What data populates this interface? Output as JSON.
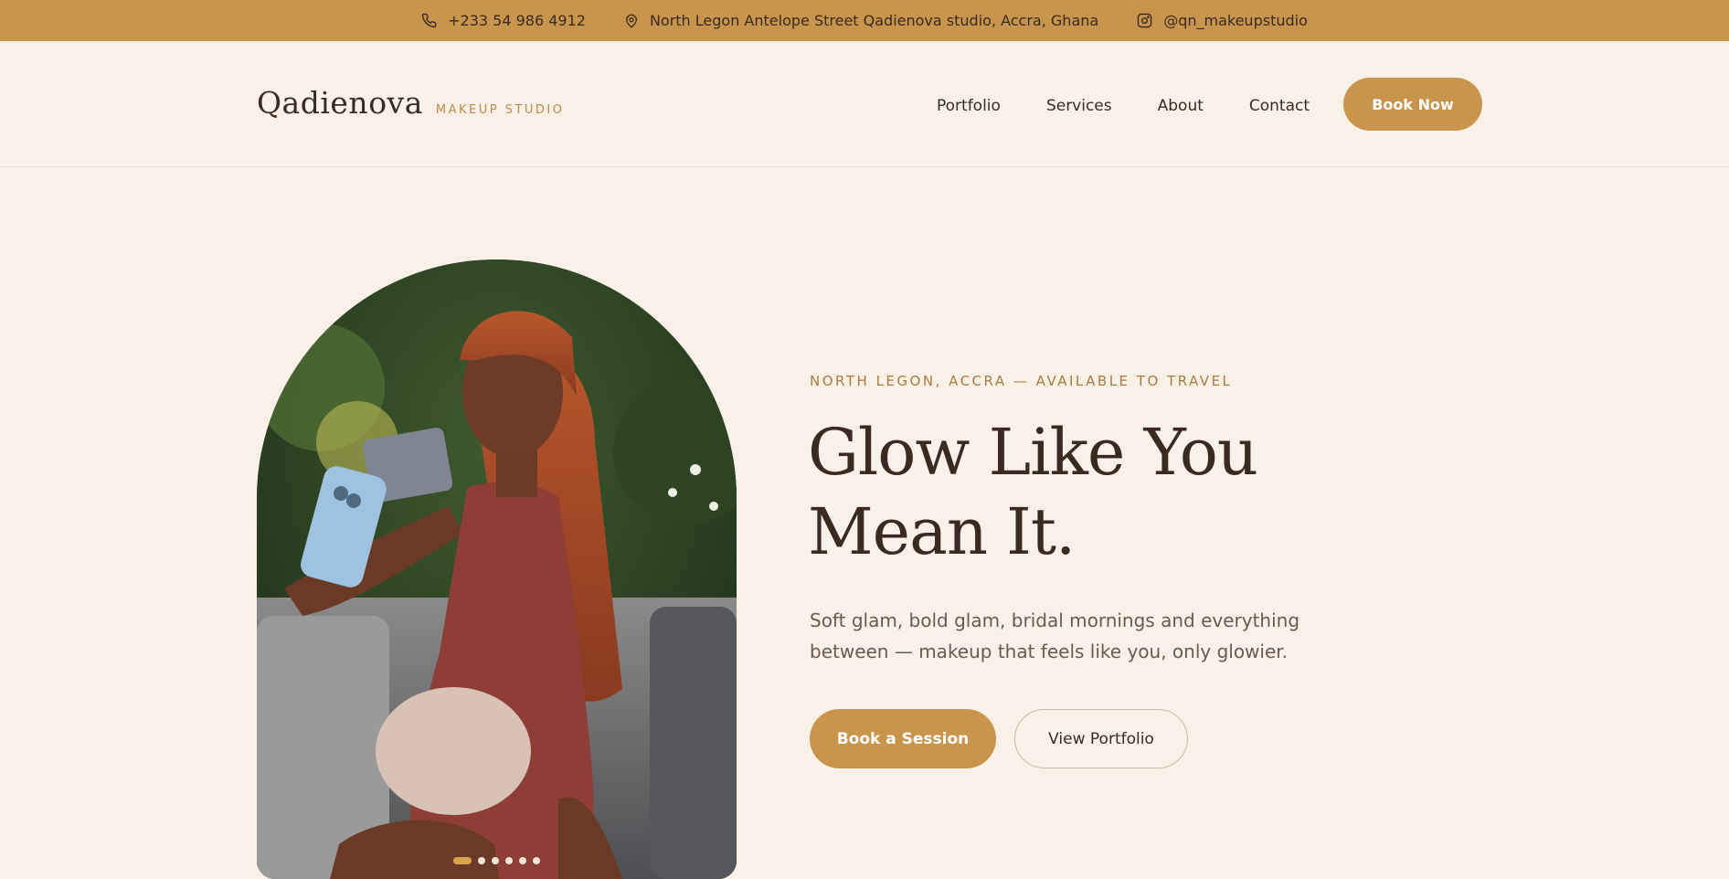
{
  "topbar": {
    "phone": "+233 54 986 4912",
    "address": "North Legon Antelope Street Qadienova studio, Accra, Ghana",
    "instagram": "@qn_makeupstudio",
    "icons": [
      "phone-icon",
      "location-pin-icon",
      "instagram-icon"
    ]
  },
  "header": {
    "logo_name": "Qadienova",
    "logo_sub": "MAKEUP STUDIO",
    "nav": [
      "Portfolio",
      "Services",
      "About",
      "Contact"
    ],
    "cta": "Book Now"
  },
  "hero": {
    "eyebrow": "NORTH LEGON, ACCRA — AVAILABLE TO TRAVEL",
    "headline_line1": "Glow Like You",
    "headline_line2": "Mean It.",
    "lede": "Soft glam, bold glam, bridal mornings and everything between — makeup that feels like you, only glowier.",
    "primary_button": "Book a Session",
    "secondary_button": "View Portfolio",
    "carousel": {
      "slides": 6,
      "active": 1
    }
  },
  "colors": {
    "background": "#f9f1e7",
    "accent": "#c9954d",
    "text": "#3a2a22",
    "muted": "#6a5a50"
  }
}
